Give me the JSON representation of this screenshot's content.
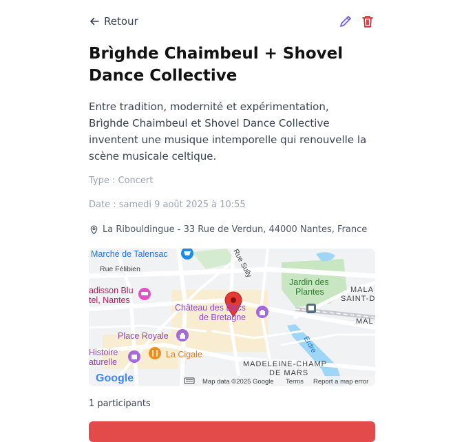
{
  "nav": {
    "back_label": "Retour"
  },
  "actions": {
    "edit_icon": "pencil-icon",
    "delete_icon": "trash-icon"
  },
  "event": {
    "title": "Brìghde Chaimbeul + Shovel Dance Collective",
    "description": "Entre tradition, modernité et expérimentation, Brìghde Chaimbeul et Shovel Dance Collective inventent une musique intemporelle qui renouvelle la scène musicale celtique.",
    "type": "Type : Concert",
    "date": "Date : samedi 9 août 2025 à 10:55",
    "location": "La Ribouldingue - 33 Rue de Verdun, 44000 Nantes, France",
    "participants": "1 participants"
  },
  "map": {
    "labels": {
      "marche": "Marché de Talensac",
      "rue_felibien": "Rue Félibien",
      "rue_sully": "Rue Sully",
      "radisson_1": "adisson Blu",
      "radisson_2": "tel, Nantes",
      "chateau_1": "Château des Ducs",
      "chateau_2": "de Bretagne",
      "jardin_1": "Jardin des",
      "jardin_2": "Plantes",
      "mala": "MALA",
      "saint_d": "SAINT-D",
      "mal": "MAL",
      "place_royale": "Place Royale",
      "histoire_1": "Histoire",
      "histoire_2": "aturelle",
      "la_cigale": "La Cigale",
      "erdre": "Erdre",
      "madeleine": "MADELEINE-CHAMP",
      "de_mars": "DE MARS",
      "google": "Google",
      "map_data": "Map data ©2025 Google",
      "terms": "Terms",
      "report": "Report a map error"
    },
    "colors": {
      "water": "#9fd5f5",
      "park": "#c8e6c1",
      "road": "#ffffff",
      "pin": "#e53935",
      "poi_purple": "#a56ad9",
      "poi_pink": "#e251c6",
      "poi_orange": "#f08c1a",
      "poi_blue": "#1a8cf0"
    }
  },
  "theme": {
    "accent": "#6d5ce8",
    "danger": "#e34b4b"
  }
}
